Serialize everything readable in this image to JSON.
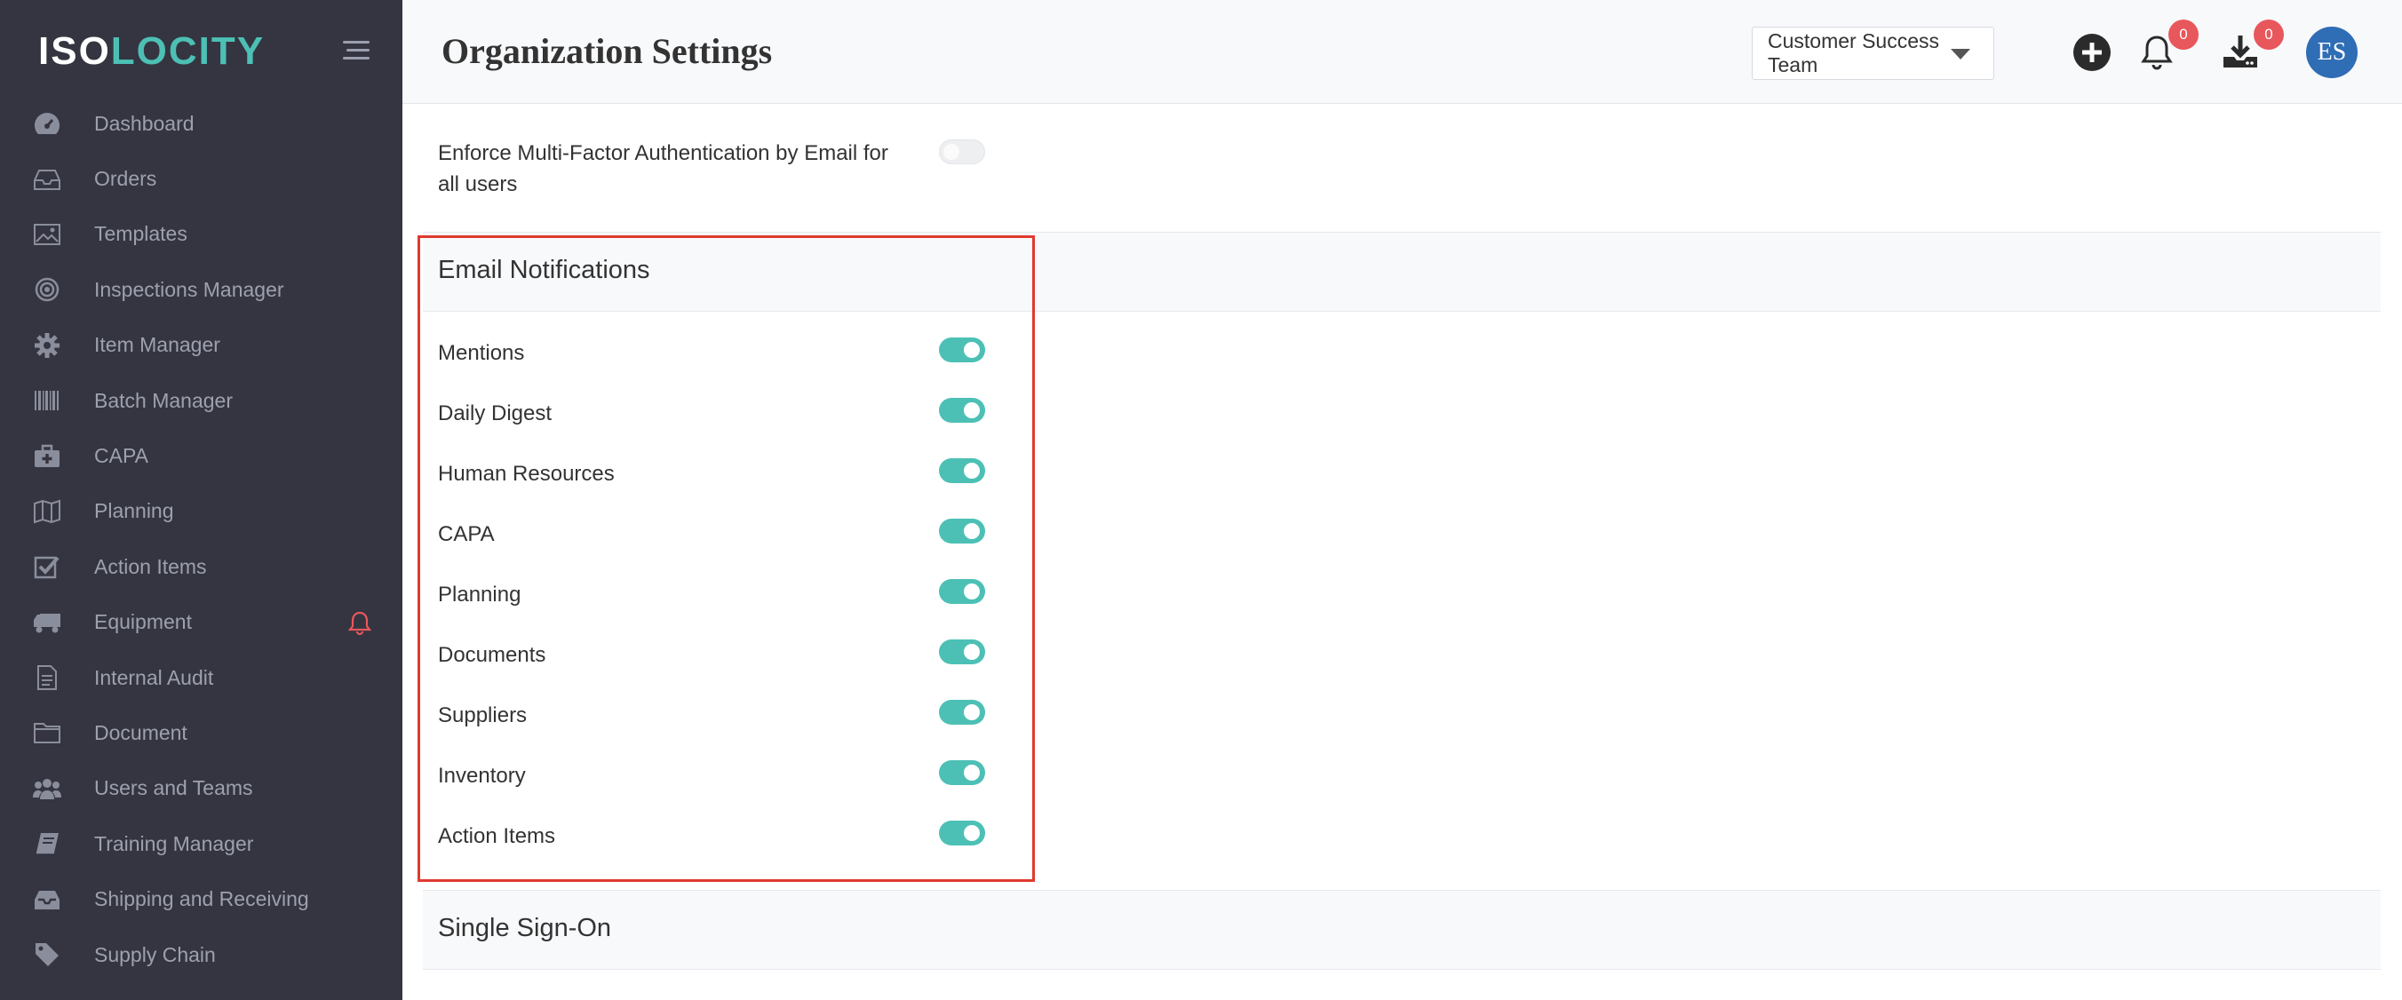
{
  "app": {
    "logo_part1": "ISO",
    "logo_part2": "LOCITY"
  },
  "sidebar": {
    "items": [
      {
        "label": "Dashboard",
        "icon": "dashboard-icon"
      },
      {
        "label": "Orders",
        "icon": "inbox-icon"
      },
      {
        "label": "Templates",
        "icon": "image-icon"
      },
      {
        "label": "Inspections Manager",
        "icon": "target-icon"
      },
      {
        "label": "Item Manager",
        "icon": "gear-icon"
      },
      {
        "label": "Batch Manager",
        "icon": "barcode-icon"
      },
      {
        "label": "CAPA",
        "icon": "medkit-icon"
      },
      {
        "label": "Planning",
        "icon": "map-icon"
      },
      {
        "label": "Action Items",
        "icon": "checkbox-icon"
      },
      {
        "label": "Equipment",
        "icon": "truck-icon"
      },
      {
        "label": "Internal Audit",
        "icon": "document-icon"
      },
      {
        "label": "Document",
        "icon": "folder-icon"
      },
      {
        "label": "Users and Teams",
        "icon": "users-icon"
      },
      {
        "label": "Training Manager",
        "icon": "book-icon"
      },
      {
        "label": "Shipping and Receiving",
        "icon": "tray-icon"
      },
      {
        "label": "Supply Chain",
        "icon": "tag-icon"
      }
    ]
  },
  "header": {
    "title": "Organization Settings",
    "team_selected": "Customer Success Team",
    "notifications_count": "0",
    "downloads_count": "0",
    "avatar_initials": "ES"
  },
  "settings": {
    "mfa_label": "Enforce Multi-Factor Authentication by Email for all users",
    "mfa_enabled": false,
    "email_section_title": "Email Notifications",
    "email_notifications": [
      {
        "label": "Mentions",
        "enabled": true
      },
      {
        "label": "Daily Digest",
        "enabled": true
      },
      {
        "label": "Human Resources",
        "enabled": true
      },
      {
        "label": "CAPA",
        "enabled": true
      },
      {
        "label": "Planning",
        "enabled": true
      },
      {
        "label": "Documents",
        "enabled": true
      },
      {
        "label": "Suppliers",
        "enabled": true
      },
      {
        "label": "Inventory",
        "enabled": true
      },
      {
        "label": "Action Items",
        "enabled": true
      }
    ],
    "sso_section_title": "Single Sign-On"
  },
  "colors": {
    "accent": "#4dc0b5",
    "sidebar_bg": "#353541",
    "badge": "#e8575b",
    "highlight": "#e03a2f",
    "avatar": "#2f6db5"
  }
}
